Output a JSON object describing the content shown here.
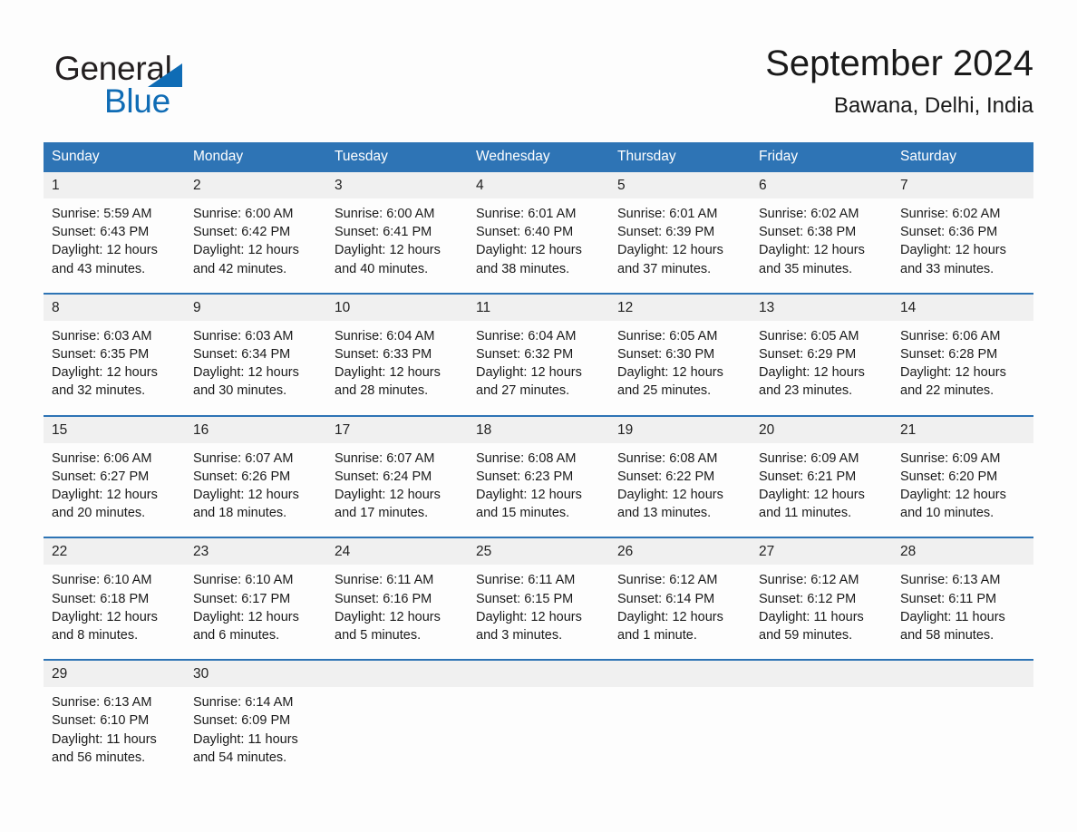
{
  "brand": {
    "name_part1": "General",
    "name_part2": "Blue",
    "accent_color": "#0f6cb5"
  },
  "header": {
    "title": "September 2024",
    "subtitle": "Bawana, Delhi, India"
  },
  "theme": {
    "header_blue": "#2e74b5",
    "date_band_gray": "#f0f0f0",
    "text": "#1a1a1a"
  },
  "weekdays": [
    "Sunday",
    "Monday",
    "Tuesday",
    "Wednesday",
    "Thursday",
    "Friday",
    "Saturday"
  ],
  "weeks": [
    {
      "days": [
        {
          "date": "1",
          "sunrise": "Sunrise: 5:59 AM",
          "sunset": "Sunset: 6:43 PM",
          "daylight_line1": "Daylight: 12 hours",
          "daylight_line2": "and 43 minutes."
        },
        {
          "date": "2",
          "sunrise": "Sunrise: 6:00 AM",
          "sunset": "Sunset: 6:42 PM",
          "daylight_line1": "Daylight: 12 hours",
          "daylight_line2": "and 42 minutes."
        },
        {
          "date": "3",
          "sunrise": "Sunrise: 6:00 AM",
          "sunset": "Sunset: 6:41 PM",
          "daylight_line1": "Daylight: 12 hours",
          "daylight_line2": "and 40 minutes."
        },
        {
          "date": "4",
          "sunrise": "Sunrise: 6:01 AM",
          "sunset": "Sunset: 6:40 PM",
          "daylight_line1": "Daylight: 12 hours",
          "daylight_line2": "and 38 minutes."
        },
        {
          "date": "5",
          "sunrise": "Sunrise: 6:01 AM",
          "sunset": "Sunset: 6:39 PM",
          "daylight_line1": "Daylight: 12 hours",
          "daylight_line2": "and 37 minutes."
        },
        {
          "date": "6",
          "sunrise": "Sunrise: 6:02 AM",
          "sunset": "Sunset: 6:38 PM",
          "daylight_line1": "Daylight: 12 hours",
          "daylight_line2": "and 35 minutes."
        },
        {
          "date": "7",
          "sunrise": "Sunrise: 6:02 AM",
          "sunset": "Sunset: 6:36 PM",
          "daylight_line1": "Daylight: 12 hours",
          "daylight_line2": "and 33 minutes."
        }
      ]
    },
    {
      "days": [
        {
          "date": "8",
          "sunrise": "Sunrise: 6:03 AM",
          "sunset": "Sunset: 6:35 PM",
          "daylight_line1": "Daylight: 12 hours",
          "daylight_line2": "and 32 minutes."
        },
        {
          "date": "9",
          "sunrise": "Sunrise: 6:03 AM",
          "sunset": "Sunset: 6:34 PM",
          "daylight_line1": "Daylight: 12 hours",
          "daylight_line2": "and 30 minutes."
        },
        {
          "date": "10",
          "sunrise": "Sunrise: 6:04 AM",
          "sunset": "Sunset: 6:33 PM",
          "daylight_line1": "Daylight: 12 hours",
          "daylight_line2": "and 28 minutes."
        },
        {
          "date": "11",
          "sunrise": "Sunrise: 6:04 AM",
          "sunset": "Sunset: 6:32 PM",
          "daylight_line1": "Daylight: 12 hours",
          "daylight_line2": "and 27 minutes."
        },
        {
          "date": "12",
          "sunrise": "Sunrise: 6:05 AM",
          "sunset": "Sunset: 6:30 PM",
          "daylight_line1": "Daylight: 12 hours",
          "daylight_line2": "and 25 minutes."
        },
        {
          "date": "13",
          "sunrise": "Sunrise: 6:05 AM",
          "sunset": "Sunset: 6:29 PM",
          "daylight_line1": "Daylight: 12 hours",
          "daylight_line2": "and 23 minutes."
        },
        {
          "date": "14",
          "sunrise": "Sunrise: 6:06 AM",
          "sunset": "Sunset: 6:28 PM",
          "daylight_line1": "Daylight: 12 hours",
          "daylight_line2": "and 22 minutes."
        }
      ]
    },
    {
      "days": [
        {
          "date": "15",
          "sunrise": "Sunrise: 6:06 AM",
          "sunset": "Sunset: 6:27 PM",
          "daylight_line1": "Daylight: 12 hours",
          "daylight_line2": "and 20 minutes."
        },
        {
          "date": "16",
          "sunrise": "Sunrise: 6:07 AM",
          "sunset": "Sunset: 6:26 PM",
          "daylight_line1": "Daylight: 12 hours",
          "daylight_line2": "and 18 minutes."
        },
        {
          "date": "17",
          "sunrise": "Sunrise: 6:07 AM",
          "sunset": "Sunset: 6:24 PM",
          "daylight_line1": "Daylight: 12 hours",
          "daylight_line2": "and 17 minutes."
        },
        {
          "date": "18",
          "sunrise": "Sunrise: 6:08 AM",
          "sunset": "Sunset: 6:23 PM",
          "daylight_line1": "Daylight: 12 hours",
          "daylight_line2": "and 15 minutes."
        },
        {
          "date": "19",
          "sunrise": "Sunrise: 6:08 AM",
          "sunset": "Sunset: 6:22 PM",
          "daylight_line1": "Daylight: 12 hours",
          "daylight_line2": "and 13 minutes."
        },
        {
          "date": "20",
          "sunrise": "Sunrise: 6:09 AM",
          "sunset": "Sunset: 6:21 PM",
          "daylight_line1": "Daylight: 12 hours",
          "daylight_line2": "and 11 minutes."
        },
        {
          "date": "21",
          "sunrise": "Sunrise: 6:09 AM",
          "sunset": "Sunset: 6:20 PM",
          "daylight_line1": "Daylight: 12 hours",
          "daylight_line2": "and 10 minutes."
        }
      ]
    },
    {
      "days": [
        {
          "date": "22",
          "sunrise": "Sunrise: 6:10 AM",
          "sunset": "Sunset: 6:18 PM",
          "daylight_line1": "Daylight: 12 hours",
          "daylight_line2": "and 8 minutes."
        },
        {
          "date": "23",
          "sunrise": "Sunrise: 6:10 AM",
          "sunset": "Sunset: 6:17 PM",
          "daylight_line1": "Daylight: 12 hours",
          "daylight_line2": "and 6 minutes."
        },
        {
          "date": "24",
          "sunrise": "Sunrise: 6:11 AM",
          "sunset": "Sunset: 6:16 PM",
          "daylight_line1": "Daylight: 12 hours",
          "daylight_line2": "and 5 minutes."
        },
        {
          "date": "25",
          "sunrise": "Sunrise: 6:11 AM",
          "sunset": "Sunset: 6:15 PM",
          "daylight_line1": "Daylight: 12 hours",
          "daylight_line2": "and 3 minutes."
        },
        {
          "date": "26",
          "sunrise": "Sunrise: 6:12 AM",
          "sunset": "Sunset: 6:14 PM",
          "daylight_line1": "Daylight: 12 hours",
          "daylight_line2": "and 1 minute."
        },
        {
          "date": "27",
          "sunrise": "Sunrise: 6:12 AM",
          "sunset": "Sunset: 6:12 PM",
          "daylight_line1": "Daylight: 11 hours",
          "daylight_line2": "and 59 minutes."
        },
        {
          "date": "28",
          "sunrise": "Sunrise: 6:13 AM",
          "sunset": "Sunset: 6:11 PM",
          "daylight_line1": "Daylight: 11 hours",
          "daylight_line2": "and 58 minutes."
        }
      ]
    },
    {
      "days": [
        {
          "date": "29",
          "sunrise": "Sunrise: 6:13 AM",
          "sunset": "Sunset: 6:10 PM",
          "daylight_line1": "Daylight: 11 hours",
          "daylight_line2": "and 56 minutes."
        },
        {
          "date": "30",
          "sunrise": "Sunrise: 6:14 AM",
          "sunset": "Sunset: 6:09 PM",
          "daylight_line1": "Daylight: 11 hours",
          "daylight_line2": "and 54 minutes."
        },
        {
          "date": "",
          "sunrise": "",
          "sunset": "",
          "daylight_line1": "",
          "daylight_line2": ""
        },
        {
          "date": "",
          "sunrise": "",
          "sunset": "",
          "daylight_line1": "",
          "daylight_line2": ""
        },
        {
          "date": "",
          "sunrise": "",
          "sunset": "",
          "daylight_line1": "",
          "daylight_line2": ""
        },
        {
          "date": "",
          "sunrise": "",
          "sunset": "",
          "daylight_line1": "",
          "daylight_line2": ""
        },
        {
          "date": "",
          "sunrise": "",
          "sunset": "",
          "daylight_line1": "",
          "daylight_line2": ""
        }
      ]
    }
  ]
}
